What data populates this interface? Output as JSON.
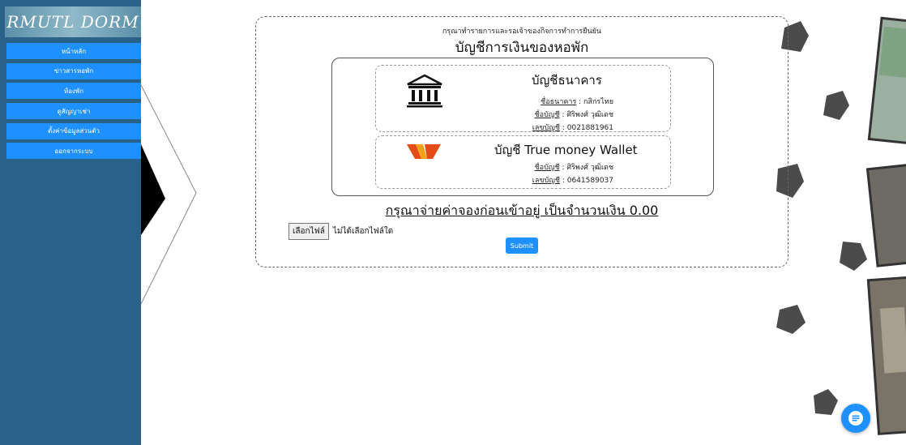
{
  "sidebar": {
    "logo": "RMUTL DORM",
    "items": [
      {
        "label": "หน้าหลัก"
      },
      {
        "label": "ข่าวสารหอพัก"
      },
      {
        "label": "ห้องพัก"
      },
      {
        "label": "ดูสัญญาเช่า"
      },
      {
        "label": "ตั้งค่าข้อมูลส่วนตัว"
      },
      {
        "label": "ออกจากระบบ"
      }
    ]
  },
  "main": {
    "subtitle": "กรุณาทำรายการและรอเจ้าของกิจการทำการยืนยัน",
    "title": "บัญชีการเงินของหอพัก",
    "bank": {
      "title": "บัญชีธนาคาร",
      "bank_label": "ชื่อธนาคาร",
      "bank_value": " : กสิกรไทย",
      "name_label": "ชื่อบัญชี",
      "name_value": " : ศิริพงศ์ วุฒิเดช",
      "number_label": "เลขบัญชี",
      "number_value": " : 0021881961"
    },
    "wallet": {
      "title": "บัญชี True money Wallet",
      "name_label": "ชื่อบัญชี",
      "name_value": " : ศิริพงศ์ วุฒิเดช",
      "number_label": "เลขบัญชี",
      "number_value": " : 0641589037"
    },
    "payment_text": "กรุณาจ่ายค่าจองก่อนเข้าอยู่ เป็นจำนวนเงิน 0.00",
    "file_button": "เลือกไฟล์",
    "file_status": "ไม่ได้เลือกไฟล์ใด",
    "submit": "Submit"
  },
  "colors": {
    "sidebar": "#2a6189",
    "menu": "#1e90ff",
    "accent": "#1e90ff"
  },
  "icons": {
    "bank": "bank-icon",
    "wallet": "truemoney-logo",
    "chat": "chat-icon"
  }
}
